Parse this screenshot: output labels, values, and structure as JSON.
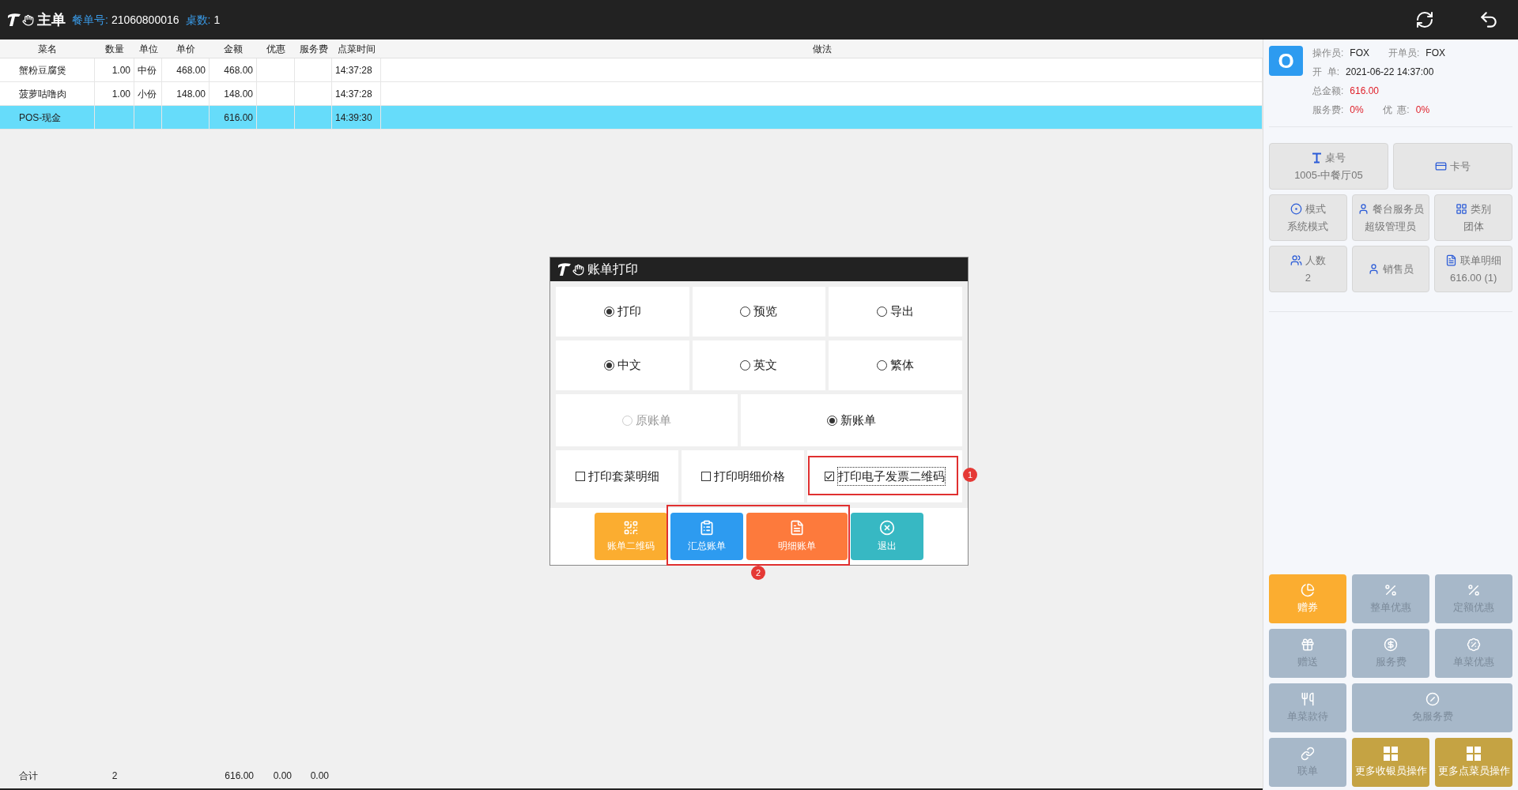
{
  "header": {
    "title": "主单",
    "order_label": "餐单号:",
    "order_no": "21060800016",
    "table_label": "桌数:",
    "table_count": "1"
  },
  "table": {
    "columns": [
      "菜名",
      "数量",
      "单位",
      "单价",
      "金额",
      "优惠",
      "服务费",
      "点菜时间",
      "做法"
    ],
    "rows": [
      {
        "name": "蟹粉豆腐煲",
        "qty": "1.00",
        "unit": "中份",
        "price": "468.00",
        "amount": "468.00",
        "time": "14:37:28",
        "selected": false
      },
      {
        "name": "菠萝咕噜肉",
        "qty": "1.00",
        "unit": "小份",
        "price": "148.00",
        "amount": "148.00",
        "time": "14:37:28",
        "selected": false
      },
      {
        "name": "POS-现金",
        "amount": "616.00",
        "time": "14:39:30",
        "selected": true
      }
    ],
    "footer": {
      "label": "合计",
      "qty": "2",
      "amount": "616.00",
      "discount": "0.00",
      "service": "0.00"
    }
  },
  "info": {
    "avatar": "O",
    "operator_label": "操作员:",
    "operator": "FOX",
    "opener_label": "开单员:",
    "opener": "FOX",
    "open_label": "开  单:",
    "open_time": "2021-06-22 14:37:00",
    "total_label": "总金额:",
    "total": "616.00",
    "service_label": "服务费:",
    "service": "0%",
    "discount_label": "优  惠:",
    "discount": "0%"
  },
  "info_buttons": [
    {
      "label": "桌号",
      "value": "1005-中餐厅05"
    },
    {
      "label": "卡号"
    },
    {
      "label": "模式",
      "value": "系统模式"
    },
    {
      "label": "餐台服务员",
      "value": "超级管理员"
    },
    {
      "label": "类别",
      "value": "团体"
    },
    {
      "label": "人数",
      "value": "2"
    },
    {
      "label": "销售员"
    },
    {
      "label": "联单明细",
      "value": "616.00 (1)"
    }
  ],
  "action_buttons": [
    {
      "label": "赠券",
      "color": "#fbad30"
    },
    {
      "label": "整单优惠",
      "color": "#a7b8c9"
    },
    {
      "label": "定额优惠",
      "color": "#a7b8c9"
    },
    {
      "label": "赠送",
      "color": "#a7b8c9"
    },
    {
      "label": "服务费",
      "color": "#a7b8c9"
    },
    {
      "label": "单菜优惠",
      "color": "#a7b8c9"
    },
    {
      "label": "单菜款待",
      "color": "#a7b8c9"
    },
    {
      "label": "免服务费",
      "color": "#a7b8c9"
    },
    {
      "label": "联单",
      "color": "#a7b8c9"
    },
    {
      "label": "更多收银员操作",
      "color": "#c5a343"
    },
    {
      "label": "更多点菜员操作",
      "color": "#c5a343"
    }
  ],
  "dialog": {
    "title": "账单打印",
    "output_options": [
      {
        "label": "打印",
        "selected": true
      },
      {
        "label": "预览",
        "selected": false
      },
      {
        "label": "导出",
        "selected": false
      }
    ],
    "language_options": [
      {
        "label": "中文",
        "selected": true
      },
      {
        "label": "英文",
        "selected": false
      },
      {
        "label": "繁体",
        "selected": false
      }
    ],
    "bill_options": [
      {
        "label": "原账单",
        "selected": false,
        "disabled": true
      },
      {
        "label": "新账单",
        "selected": true,
        "disabled": false
      }
    ],
    "checkboxes": [
      {
        "label": "打印套菜明细",
        "checked": false
      },
      {
        "label": "打印明细价格",
        "checked": false
      },
      {
        "label": "打印电子发票二维码",
        "checked": true
      }
    ],
    "buttons": [
      {
        "label": "账单二维码",
        "color": "#fbad30"
      },
      {
        "label": "汇总账单",
        "color": "#2d9bf0"
      },
      {
        "label": "明细账单",
        "color": "#fd7a3c"
      },
      {
        "label": "退出",
        "color": "#37b8c3"
      }
    ],
    "annotations": [
      "1",
      "2"
    ]
  }
}
